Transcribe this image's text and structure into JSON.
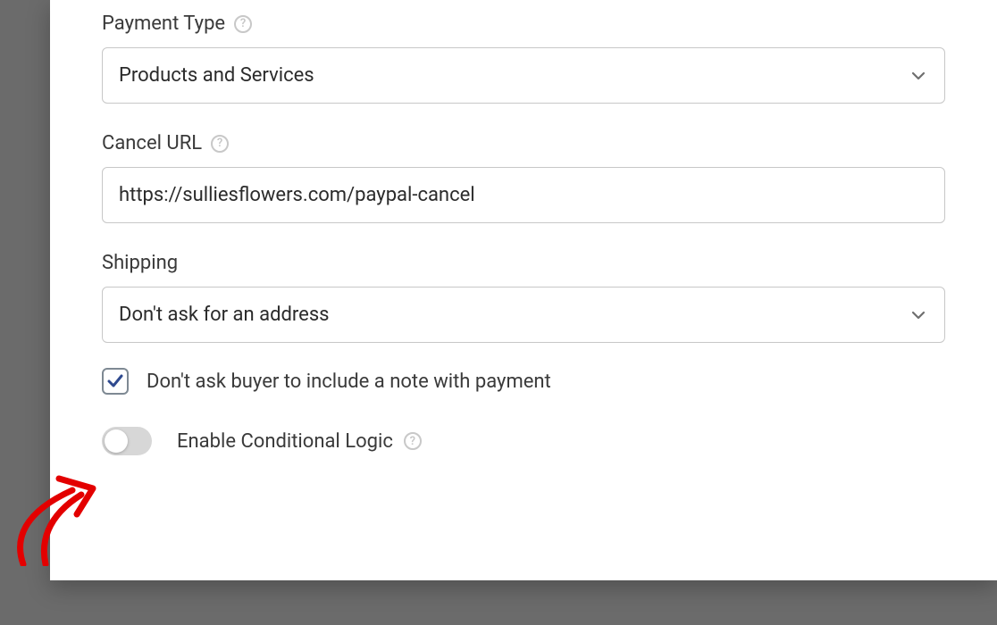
{
  "fields": {
    "payment_type": {
      "label": "Payment Type",
      "value": "Products and Services"
    },
    "cancel_url": {
      "label": "Cancel URL",
      "value": "https://sulliesflowers.com/paypal-cancel"
    },
    "shipping": {
      "label": "Shipping",
      "value": "Don't ask for an address"
    },
    "note_checkbox": {
      "label": "Don't ask buyer to include a note with payment",
      "checked": true
    },
    "conditional_logic": {
      "label": "Enable Conditional Logic",
      "enabled": false
    }
  }
}
